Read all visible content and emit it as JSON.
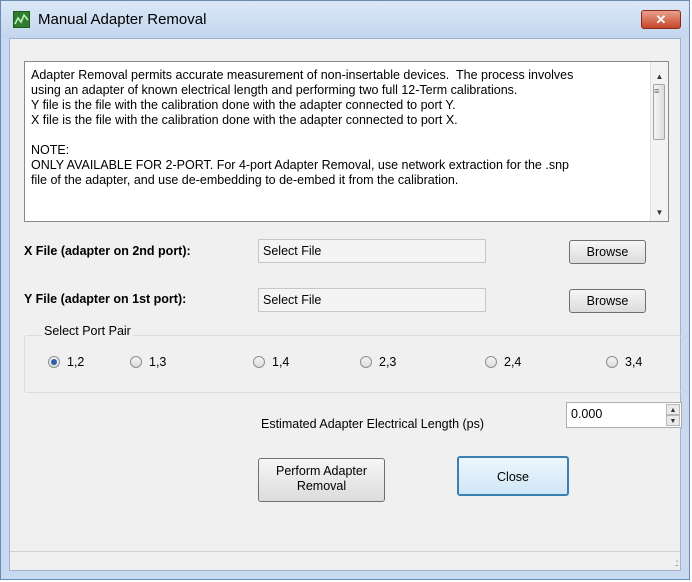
{
  "window": {
    "title": "Manual Adapter Removal",
    "close_glyph": "✕",
    "icon": "app-logo-icon"
  },
  "info": {
    "lines": [
      "Adapter Removal permits accurate measurement of non-insertable devices.  The process involves",
      "using an adapter of known electrical length and performing two full 12-Term calibrations.",
      "Y file is the file with the calibration done with the adapter connected to port Y.",
      "X file is the file with the calibration done with the adapter connected to port X.",
      "",
      "NOTE:",
      "ONLY AVAILABLE FOR 2-PORT. For 4-port Adapter Removal, use network extraction for the .snp",
      "file of the adapter, and use de-embedding to de-embed it from the calibration."
    ]
  },
  "x_file": {
    "label": "X File (adapter on 2nd port):",
    "value": "Select File",
    "button": "Browse"
  },
  "y_file": {
    "label": "Y File (adapter on 1st port):",
    "value": "Select File",
    "button": "Browse"
  },
  "port_pair": {
    "title": "Select Port Pair",
    "options": [
      "1,2",
      "1,3",
      "1,4",
      "2,3",
      "2,4",
      "3,4"
    ],
    "selected": "1,2"
  },
  "electrical_length": {
    "label": "Estimated Adapter Electrical Length (ps)",
    "value": "0.000"
  },
  "buttons": {
    "perform_line1": "Perform Adapter",
    "perform_line2": "Removal",
    "close": "Close"
  },
  "colors": {
    "title_bg": "#c9daf0",
    "client_bg": "#f0f0f0",
    "close_button": "#c7452a",
    "radio_selected": "#2b5fa8"
  }
}
